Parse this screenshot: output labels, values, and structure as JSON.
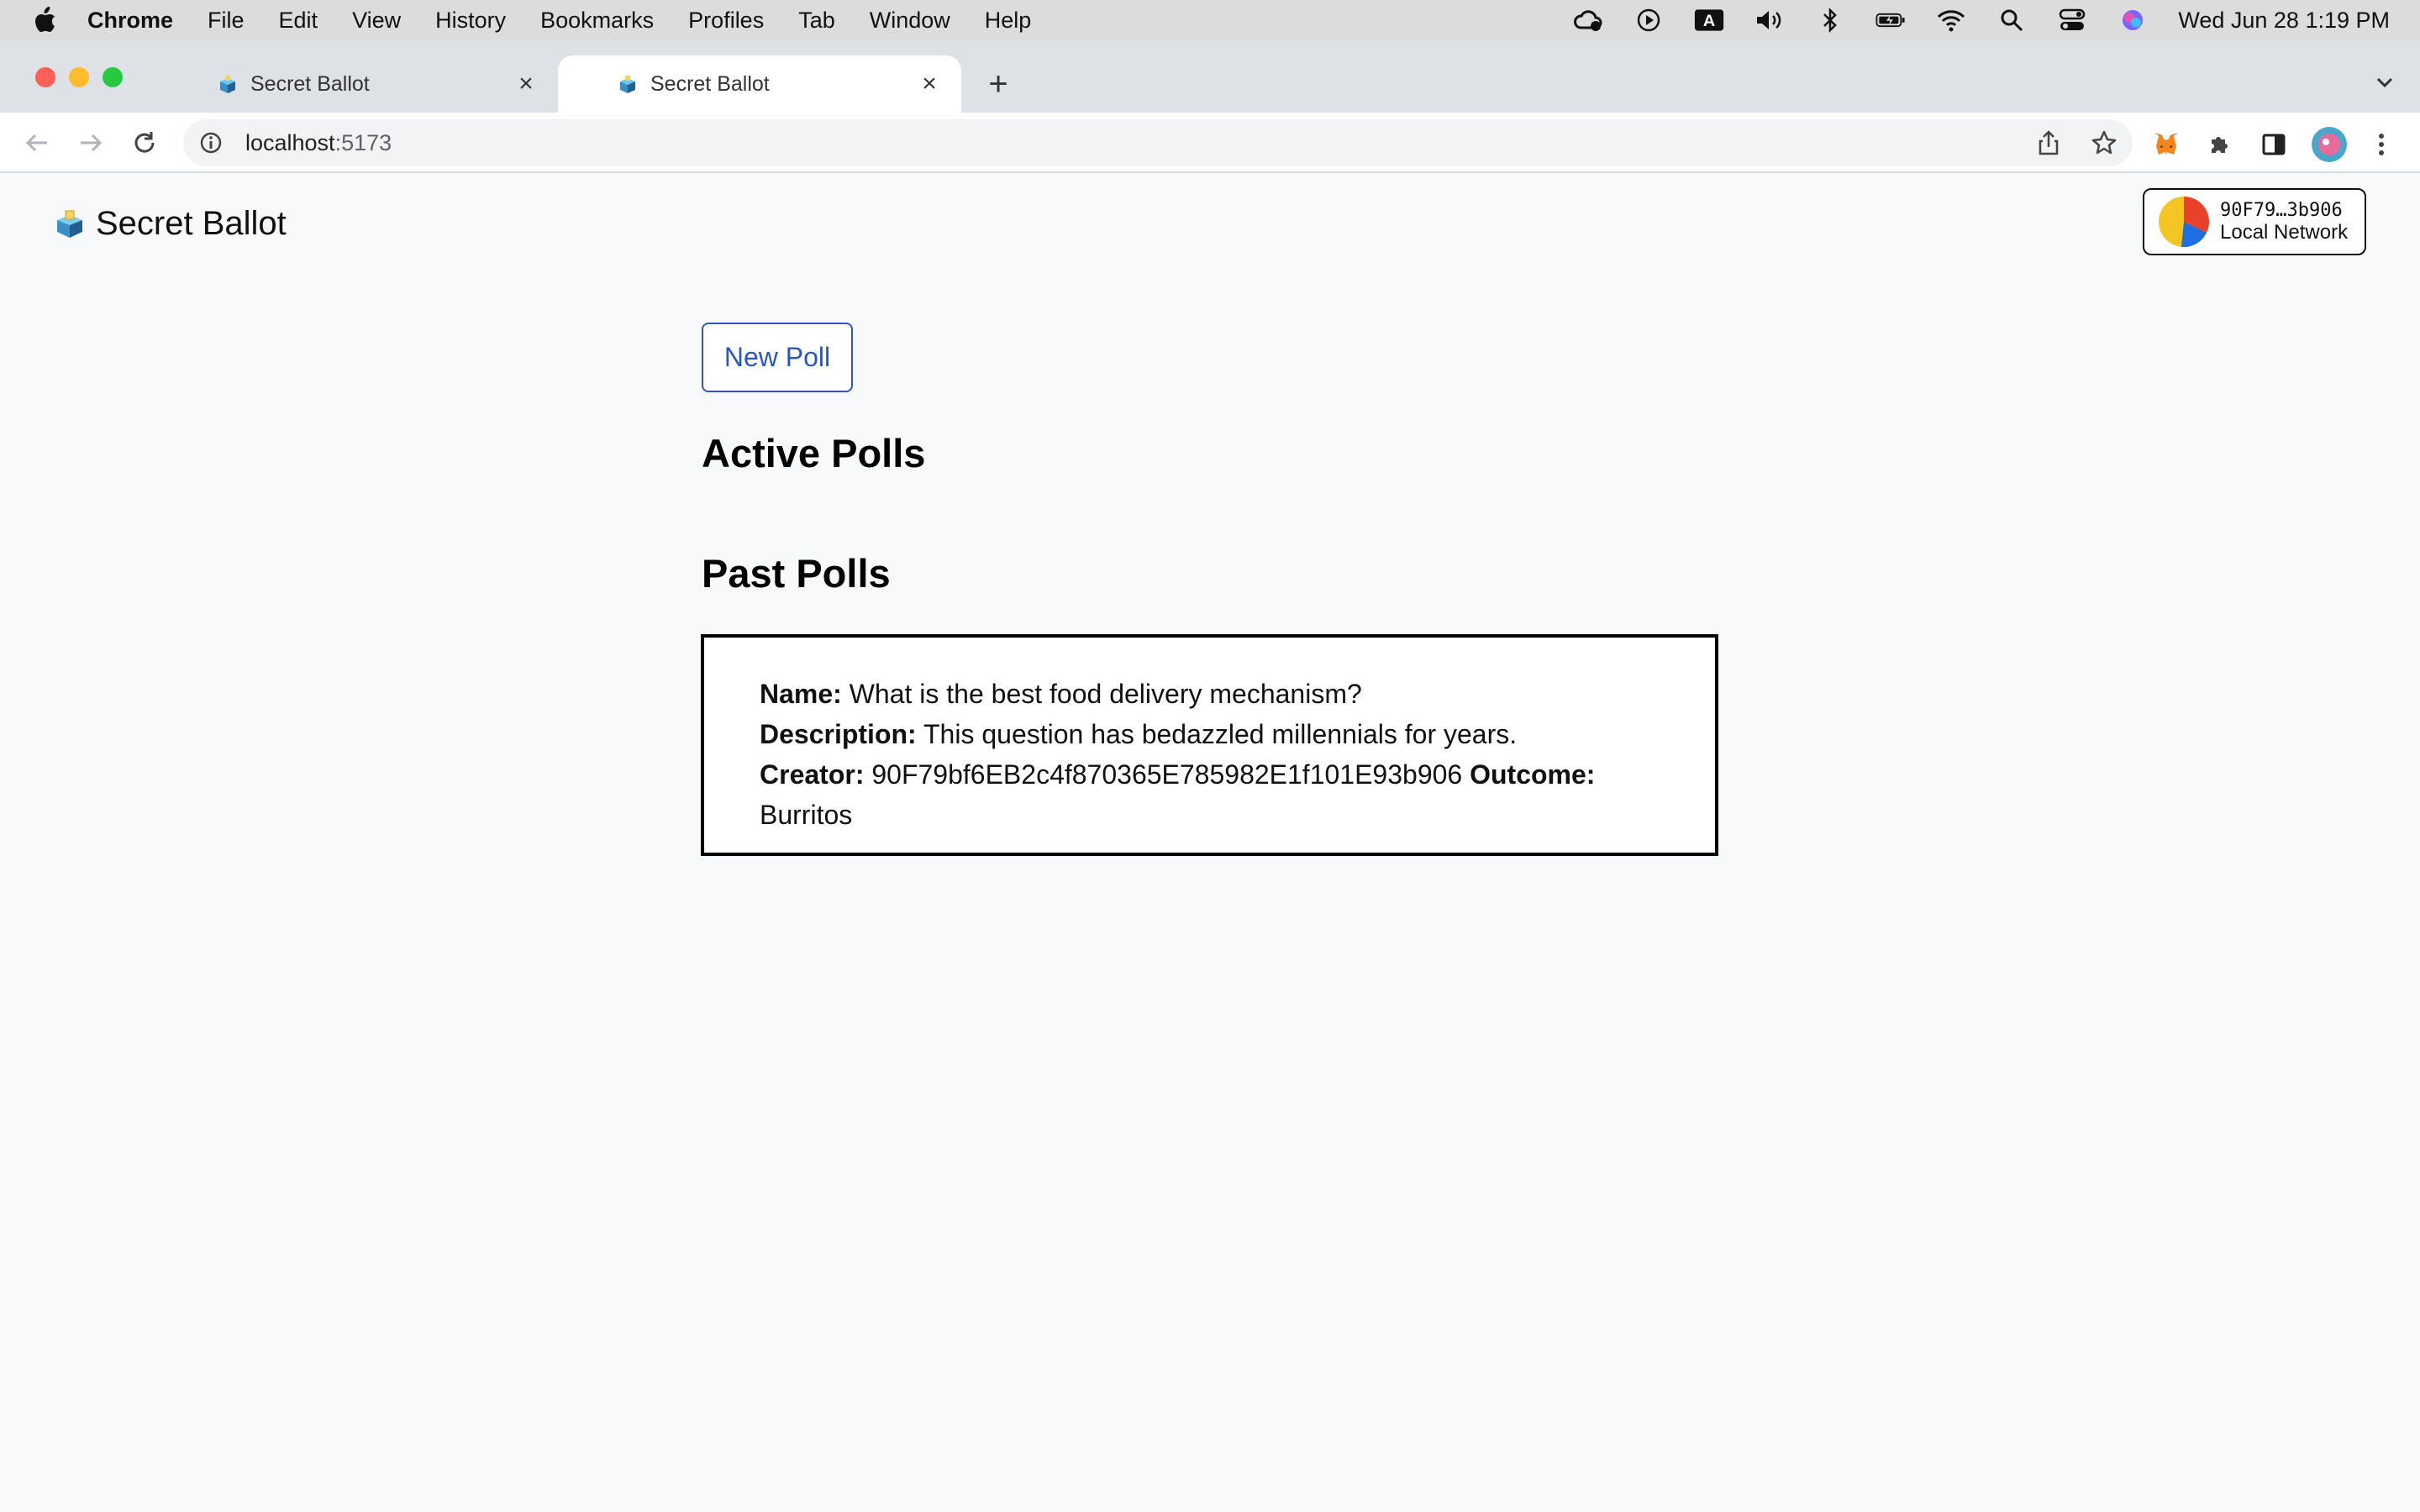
{
  "menubar": {
    "app": "Chrome",
    "items": [
      "File",
      "Edit",
      "View",
      "History",
      "Bookmarks",
      "Profiles",
      "Tab",
      "Window",
      "Help"
    ],
    "clock": "Wed Jun 28  1:19 PM",
    "status_icons": [
      "creative-cloud-icon",
      "play-icon",
      "input-source-a-icon",
      "volume-icon",
      "bluetooth-icon",
      "battery-icon",
      "wifi-icon",
      "spotlight-search-icon",
      "control-center-icon",
      "siri-icon"
    ]
  },
  "browser": {
    "tabs": [
      {
        "title": "Secret Ballot",
        "active": false
      },
      {
        "title": "Secret Ballot",
        "active": true
      }
    ],
    "address": {
      "host": "localhost",
      "port": ":5173"
    }
  },
  "app": {
    "title": "Secret Ballot",
    "wallet": {
      "address": "90F79…3b906",
      "network": "Local Network"
    },
    "new_poll_label": "New Poll",
    "active_heading": "Active Polls",
    "past_heading": "Past Polls",
    "past_polls": [
      {
        "name_label": "Name:",
        "name": "What is the best food delivery mechanism?",
        "description_label": "Description:",
        "description": "This question has bedazzled millennials for years.",
        "creator_label": "Creator:",
        "creator": "90F79bf6EB2c4f870365E785982E1f101E93b906",
        "outcome_label": "Outcome:",
        "outcome": "Burritos"
      }
    ]
  },
  "colors": {
    "accent": "#2d56c5",
    "page_bg": "#f8f9fb",
    "tabstrip_bg": "#dee1e6"
  }
}
